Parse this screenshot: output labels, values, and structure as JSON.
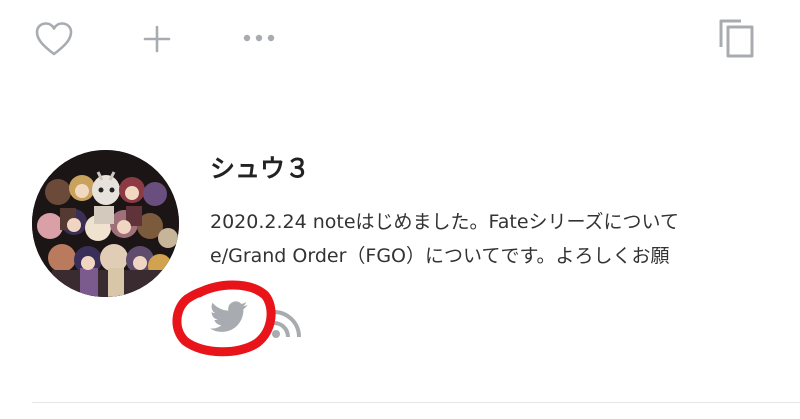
{
  "author": {
    "name": "シュウ３",
    "bio_line_1": "2020.2.24 noteはじめました。Fateシリーズについて",
    "bio_line_2": "e/Grand Order（FGO）についてです。よろしくお願"
  },
  "icons": {
    "like": "heart-icon",
    "add": "plus-icon",
    "more": "more-dots-icon",
    "copy": "copy-icon",
    "twitter": "twitter-bird-icon",
    "rss": "rss-icon"
  },
  "colors": {
    "icon_gray": "#a8acb0",
    "text": "#222222",
    "highlight": "#e8141a"
  }
}
